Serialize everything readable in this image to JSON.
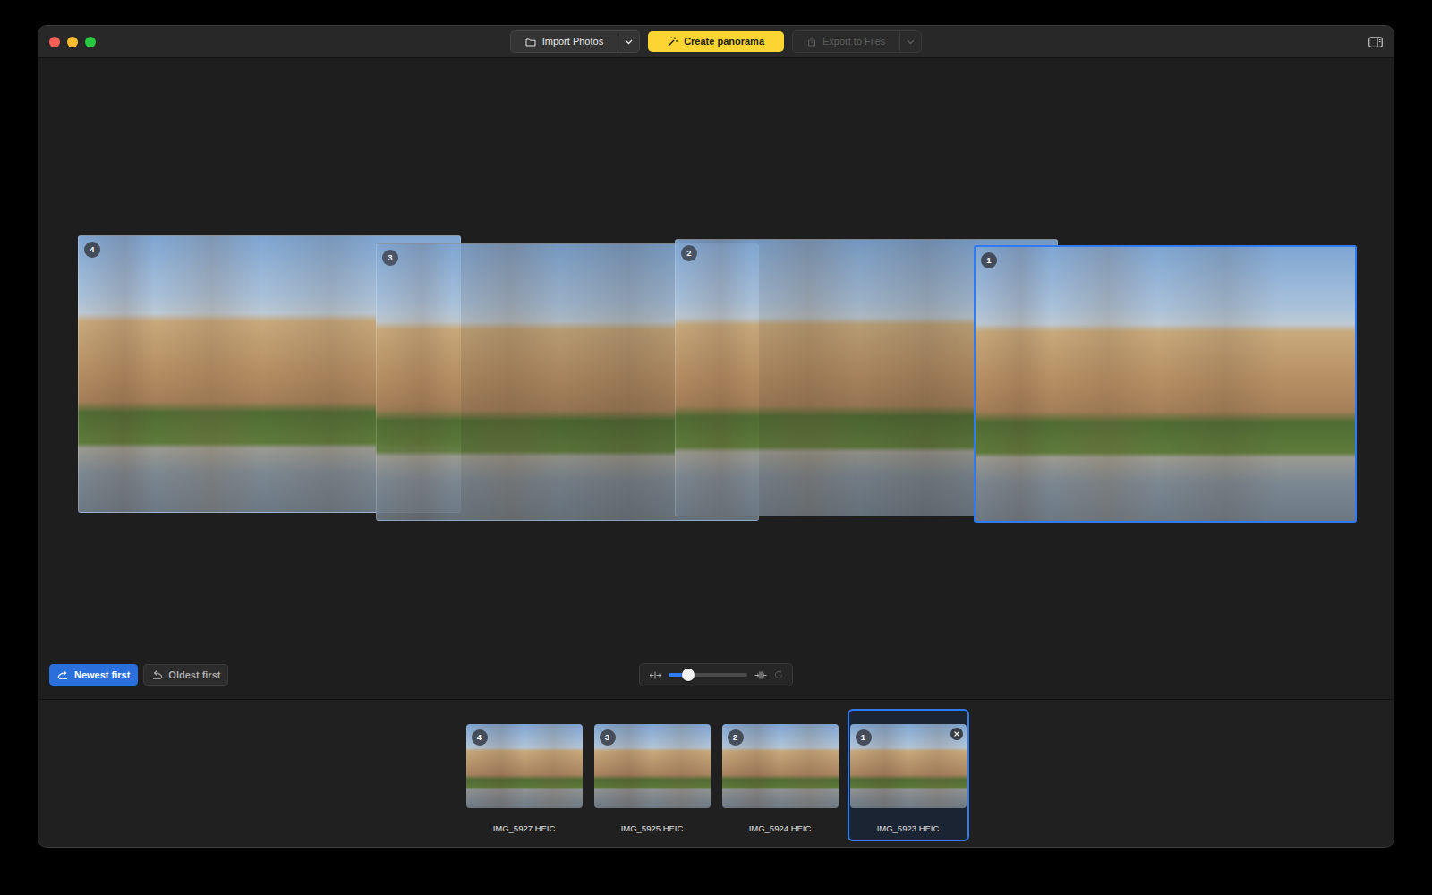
{
  "toolbar": {
    "import_button": {
      "label": "Import Photos",
      "disabled": false
    },
    "create_button": {
      "label": "Create panorama",
      "disabled": false
    },
    "export_button": {
      "label": "Export to Files",
      "disabled": true
    }
  },
  "canvas": {
    "photos": [
      {
        "number": "4",
        "selected": false
      },
      {
        "number": "3",
        "selected": false
      },
      {
        "number": "2",
        "selected": false
      },
      {
        "number": "1",
        "selected": true
      }
    ]
  },
  "sort": [
    {
      "label": "Newest first",
      "selected": true
    },
    {
      "label": "Oldest first",
      "selected": false
    }
  ],
  "spacing_slider": {
    "level": 0.25
  },
  "filmstrip": [
    {
      "number": "4",
      "filename": "IMG_5927.HEIC",
      "selected": false
    },
    {
      "number": "3",
      "filename": "IMG_5925.HEIC",
      "selected": false
    },
    {
      "number": "2",
      "filename": "IMG_5924.HEIC",
      "selected": false
    },
    {
      "number": "1",
      "filename": "IMG_5923.HEIC",
      "selected": true
    }
  ]
}
